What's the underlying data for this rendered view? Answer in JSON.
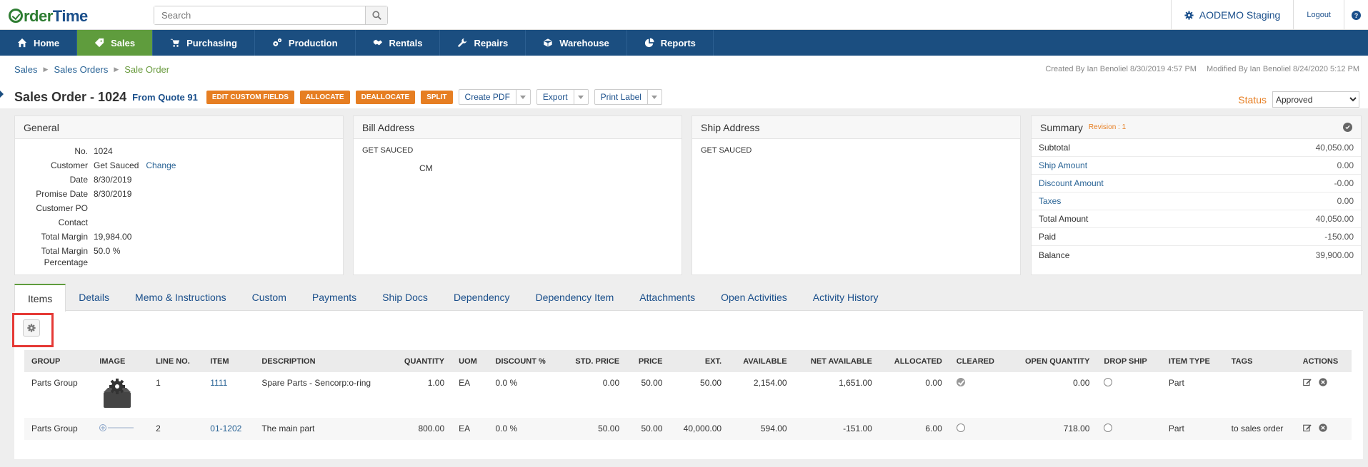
{
  "header": {
    "brand": {
      "part1": "rder",
      "part2": "Time"
    },
    "search_placeholder": "Search",
    "company": "AODEMO Staging",
    "logout": "Logout"
  },
  "nav": [
    {
      "label": "Home",
      "icon": "home-icon",
      "active": false
    },
    {
      "label": "Sales",
      "icon": "tag-icon",
      "active": true
    },
    {
      "label": "Purchasing",
      "icon": "cart-icon",
      "active": false
    },
    {
      "label": "Production",
      "icon": "gears-icon",
      "active": false
    },
    {
      "label": "Rentals",
      "icon": "handshake-icon",
      "active": false
    },
    {
      "label": "Repairs",
      "icon": "wrench-icon",
      "active": false
    },
    {
      "label": "Warehouse",
      "icon": "box-icon",
      "active": false
    },
    {
      "label": "Reports",
      "icon": "pie-chart-icon",
      "active": false
    }
  ],
  "breadcrumb": {
    "c1": "Sales",
    "c2": "Sales Orders",
    "c3": "Sale Order"
  },
  "audit": {
    "created": "Created By Ian Benoliel 8/30/2019 4:57 PM",
    "modified": "Modified By Ian Benoliel 8/24/2020 5:12 PM"
  },
  "title": {
    "text": "Sales Order - 1024",
    "quote": "From Quote 91",
    "btn_custom": "EDIT CUSTOM FIELDS",
    "btn_allocate": "ALLOCATE",
    "btn_deallocate": "DEALLOCATE",
    "btn_split": "SPLIT",
    "btn_pdf": "Create PDF",
    "btn_export": "Export",
    "btn_label": "Print Label",
    "status_label": "Status",
    "status_value": "Approved"
  },
  "general": {
    "heading": "General",
    "no_k": "No.",
    "no_v": "1024",
    "customer_k": "Customer",
    "customer_v": "Get Sauced",
    "change": "Change",
    "date_k": "Date",
    "date_v": "8/30/2019",
    "promise_k": "Promise Date",
    "promise_v": "8/30/2019",
    "po_k": "Customer PO",
    "po_v": "",
    "contact_k": "Contact",
    "contact_v": "",
    "margin_k": "Total Margin",
    "margin_v": "19,984.00",
    "marginpct_k": "Total Margin Percentage",
    "marginpct_v": "50.0 %"
  },
  "bill": {
    "heading": "Bill Address",
    "line1": "GET SAUCED",
    "line2": "CM"
  },
  "ship": {
    "heading": "Ship Address",
    "line1": "GET SAUCED"
  },
  "summary": {
    "heading": "Summary",
    "revision": "Revision : 1",
    "subtotal_k": "Subtotal",
    "subtotal_v": "40,050.00",
    "ship_k": "Ship Amount",
    "ship_v": "0.00",
    "discount_k": "Discount Amount",
    "discount_v": "-0.00",
    "taxes_k": "Taxes",
    "taxes_v": "0.00",
    "total_k": "Total Amount",
    "total_v": "40,050.00",
    "paid_k": "Paid",
    "paid_v": "-150.00",
    "balance_k": "Balance",
    "balance_v": "39,900.00"
  },
  "tabs": [
    "Items",
    "Details",
    "Memo & Instructions",
    "Custom",
    "Payments",
    "Ship Docs",
    "Dependency",
    "Dependency Item",
    "Attachments",
    "Open Activities",
    "Activity History"
  ],
  "table": {
    "headers": [
      "GROUP",
      "IMAGE",
      "LINE NO.",
      "ITEM",
      "DESCRIPTION",
      "QUANTITY",
      "UOM",
      "DISCOUNT %",
      "STD. PRICE",
      "PRICE",
      "EXT.",
      "AVAILABLE",
      "NET AVAILABLE",
      "ALLOCATED",
      "CLEARED",
      "OPEN QUANTITY",
      "DROP SHIP",
      "ITEM TYPE",
      "TAGS",
      "ACTIONS"
    ],
    "rows": [
      {
        "group": "Parts Group",
        "line": "1",
        "item": "1111",
        "desc": "Spare Parts - Sencorp:o-ring",
        "qty": "1.00",
        "uom": "EA",
        "disc": "0.0 %",
        "std": "0.00",
        "price": "50.00",
        "ext": "50.00",
        "avail": "2,154.00",
        "net": "1,651.00",
        "alloc": "0.00",
        "cleared": true,
        "openq": "0.00",
        "type": "Part",
        "tags": ""
      },
      {
        "group": "Parts Group",
        "line": "2",
        "item": "01-1202",
        "desc": "The main part",
        "qty": "800.00",
        "uom": "EA",
        "disc": "0.0 %",
        "std": "50.00",
        "price": "50.00",
        "ext": "40,000.00",
        "avail": "594.00",
        "net": "-151.00",
        "alloc": "6.00",
        "cleared": false,
        "openq": "718.00",
        "type": "Part",
        "tags": "to sales order"
      }
    ]
  }
}
